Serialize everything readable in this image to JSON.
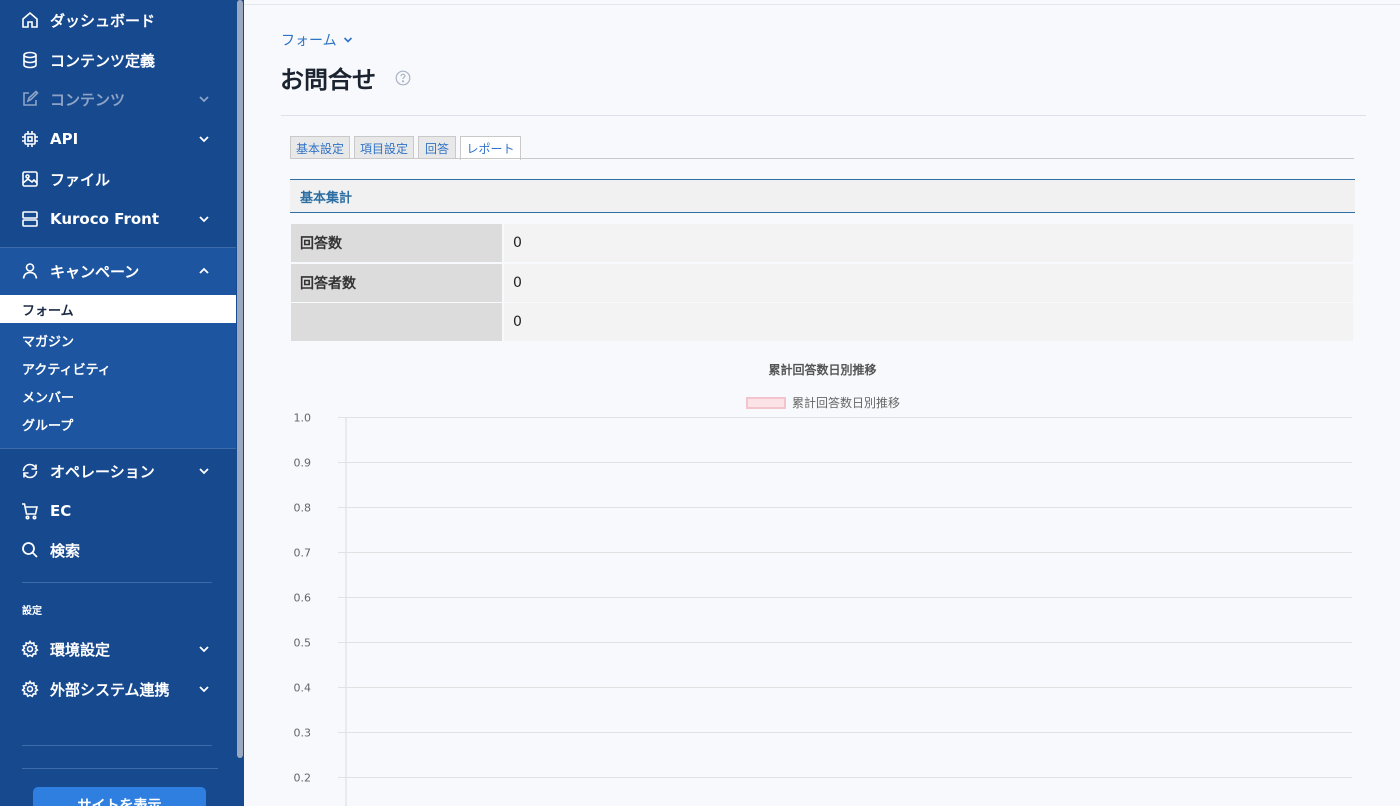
{
  "sidebar": {
    "items": [
      {
        "label": "ダッシュボード",
        "icon": "home-icon"
      },
      {
        "label": "コンテンツ定義",
        "icon": "database-icon"
      },
      {
        "label": "コンテンツ",
        "icon": "edit-icon",
        "disabled": true
      },
      {
        "label": "API",
        "icon": "chip-icon"
      },
      {
        "label": "ファイル",
        "icon": "image-icon"
      },
      {
        "label": "Kuroco Front",
        "icon": "server-icon"
      },
      {
        "label": "キャンペーン",
        "icon": "user-icon"
      }
    ],
    "campaign_sub": [
      "フォーム",
      "マガジン",
      "アクティビティ",
      "メンバー",
      "グループ"
    ],
    "items2": [
      {
        "label": "オペレーション",
        "icon": "refresh-icon"
      },
      {
        "label": "EC",
        "icon": "cart-icon"
      },
      {
        "label": "検索",
        "icon": "search-icon"
      }
    ],
    "settings_label": "設定",
    "settings_items": [
      {
        "label": "環境設定",
        "icon": "gear-icon"
      },
      {
        "label": "外部システム連携",
        "icon": "gear-icon"
      }
    ],
    "view_site_button": "サイトを表示"
  },
  "breadcrumb": "フォーム",
  "page_title": "お問合せ",
  "tabs": [
    "基本設定",
    "項目設定",
    "回答",
    "レポート"
  ],
  "active_tab": "レポート",
  "section_title": "基本集計",
  "stats": [
    {
      "label": "回答数",
      "value": "0"
    },
    {
      "label": "回答者数",
      "value": "0"
    },
    {
      "label": "",
      "value": "0"
    }
  ],
  "chart_data": {
    "type": "line",
    "title": "累計回答数日別推移",
    "series": [
      {
        "name": "累計回答数日別推移",
        "values": [],
        "color": "#f3c4cc"
      }
    ],
    "y_ticks": [
      "1.0",
      "0.9",
      "0.8",
      "0.7",
      "0.6",
      "0.5",
      "0.4",
      "0.3",
      "0.2"
    ],
    "ylim": [
      0,
      1.0
    ],
    "grid": true,
    "legend": "top-center"
  },
  "colors": {
    "sidebar_bg": "#17498f",
    "accent": "#2f73c6",
    "section_border": "#2d6fa3"
  }
}
